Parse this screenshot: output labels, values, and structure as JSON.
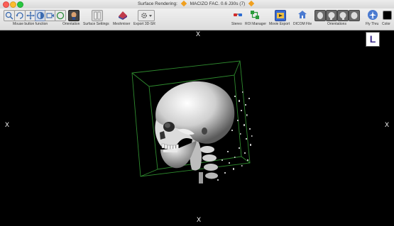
{
  "window": {
    "title_left": "Surface Rendering:",
    "title_right": "MACIZO FAC. 0.6 J30s (7)"
  },
  "toolbar": {
    "mouse_label": "Mouse button function",
    "orientation_label": "Orientation",
    "surface_settings_label": "Surface Settings",
    "meshmixer_label": "Meshmixer",
    "export_label": "Export 3D-SR",
    "stereo_label": "Stereo",
    "roi_label": "ROI Manager",
    "movie_label": "Movie Export",
    "dicom_label": "DICOM File",
    "orientations_label": "Orientations",
    "flythru_label": "Fly Thru",
    "color_label": "Color"
  },
  "viewport": {
    "marker_top": "X",
    "marker_left": "X",
    "marker_right": "X",
    "marker_bottom": "X",
    "orientation_letter": "L"
  }
}
